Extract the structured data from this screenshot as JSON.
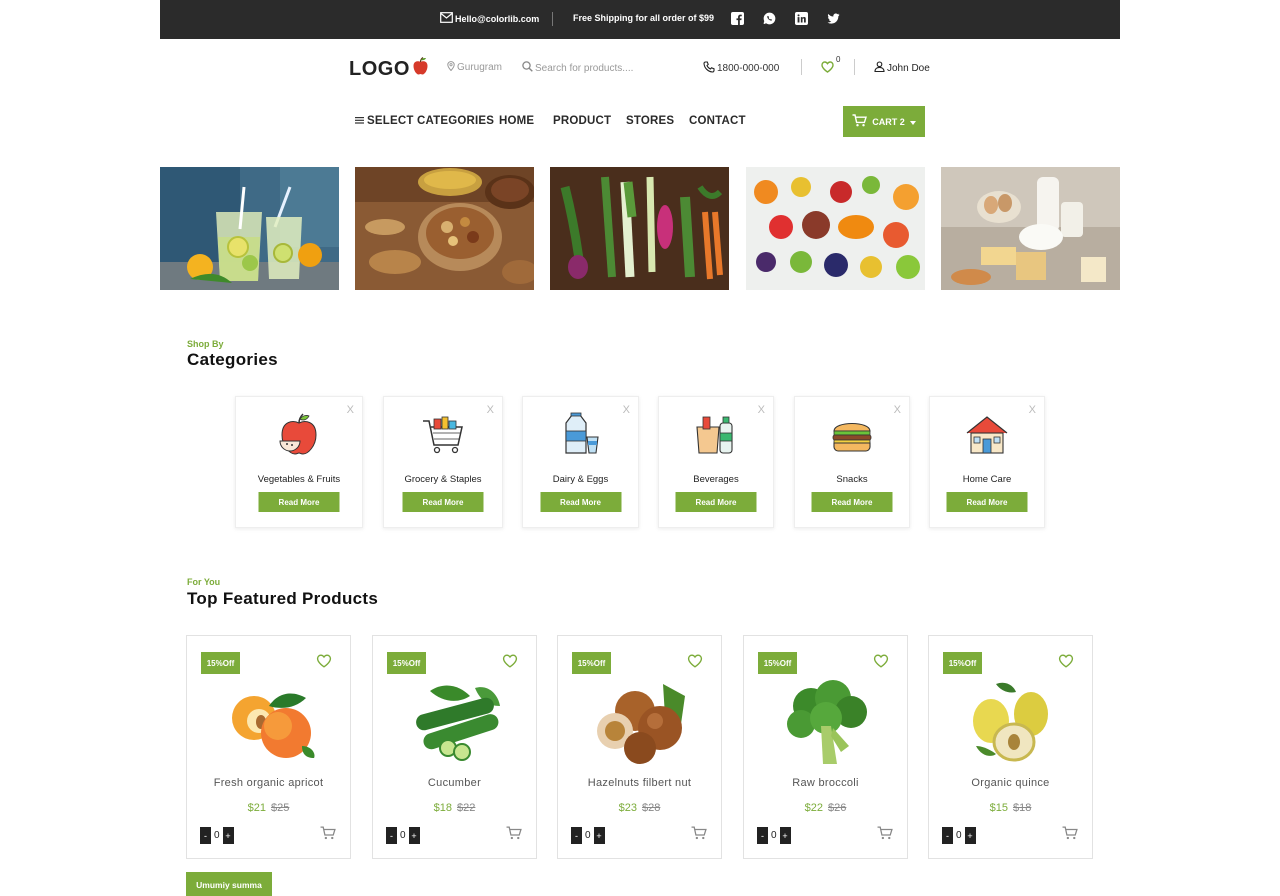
{
  "topbar": {
    "email": "Hello@colorlib.com",
    "shipping": "Free Shipping for all order of $99",
    "social": [
      "facebook-icon",
      "whatsapp-icon",
      "linkedin-icon",
      "twitter-icon"
    ]
  },
  "header": {
    "logo": "LOGO",
    "location": "Gurugram",
    "search_placeholder": "Search for products....",
    "phone": "1800-000-000",
    "wishlist_count": "0",
    "user": "John Doe"
  },
  "nav": {
    "categories": "SELECT CATEGORIES",
    "items": [
      "HOME",
      "PRODUCT",
      "STORES",
      "CONTACT"
    ],
    "cart": "CART 2"
  },
  "categories_section": {
    "eyebrow": "Shop By",
    "title": "Categories",
    "read_more": "Read More",
    "close": "X",
    "items": [
      {
        "name": "Vegetables & Fruits",
        "icon": "apple-icon"
      },
      {
        "name": "Grocery & Staples",
        "icon": "shopping-cart-icon"
      },
      {
        "name": "Dairy & Eggs",
        "icon": "milk-icon"
      },
      {
        "name": "Beverages",
        "icon": "beverages-icon"
      },
      {
        "name": "Snacks",
        "icon": "burger-icon"
      },
      {
        "name": "Home Care",
        "icon": "house-icon"
      }
    ]
  },
  "featured": {
    "eyebrow": "For You",
    "title": "Top Featured Products",
    "products": [
      {
        "badge": "15%Off",
        "name": "Fresh organic apricot",
        "price": "$21",
        "old_price": "$25",
        "qty": "0"
      },
      {
        "badge": "15%Off",
        "name": "Cucumber",
        "price": "$18",
        "old_price": "$22",
        "qty": "0"
      },
      {
        "badge": "15%Off",
        "name": "Hazelnuts filbert nut",
        "price": "$23",
        "old_price": "$28",
        "qty": "0"
      },
      {
        "badge": "15%Off",
        "name": "Raw broccoli",
        "price": "$22",
        "old_price": "$26",
        "qty": "0"
      },
      {
        "badge": "15%Off",
        "name": "Organic quince",
        "price": "$15",
        "old_price": "$18",
        "qty": "0"
      }
    ],
    "more_button": "Umumiy summa"
  },
  "colors": {
    "accent": "#7cac3a",
    "topbar": "#2b2b2b"
  }
}
